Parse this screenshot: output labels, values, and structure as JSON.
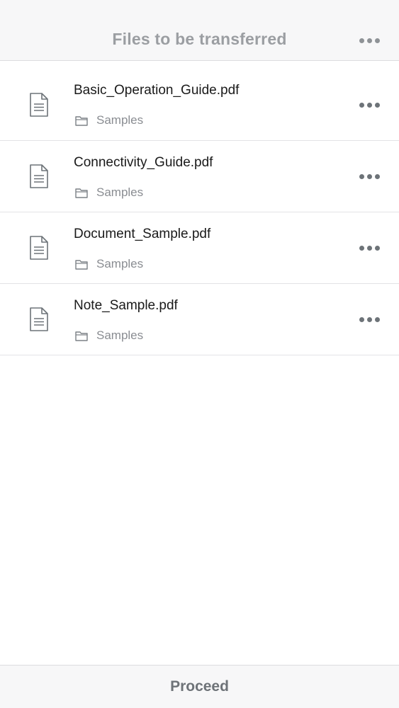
{
  "header": {
    "title": "Files to be transferred",
    "more_icon": "more-horizontal-icon"
  },
  "files": [
    {
      "name": "Basic_Operation_Guide.pdf",
      "folder": "Samples",
      "icon": "document-icon"
    },
    {
      "name": "Connectivity_Guide.pdf",
      "folder": "Samples",
      "icon": "document-icon"
    },
    {
      "name": "Document_Sample.pdf",
      "folder": "Samples",
      "icon": "document-icon"
    },
    {
      "name": "Note_Sample.pdf",
      "folder": "Samples",
      "icon": "document-icon"
    }
  ],
  "footer": {
    "proceed_label": "Proceed"
  },
  "colors": {
    "bar_background": "#f7f7f8",
    "title_text": "#9b9ea2",
    "file_name_text": "#1a1a1a",
    "folder_text": "#8a8d92",
    "icon_stroke": "#6d7378",
    "proceed_text": "#6e7378"
  }
}
